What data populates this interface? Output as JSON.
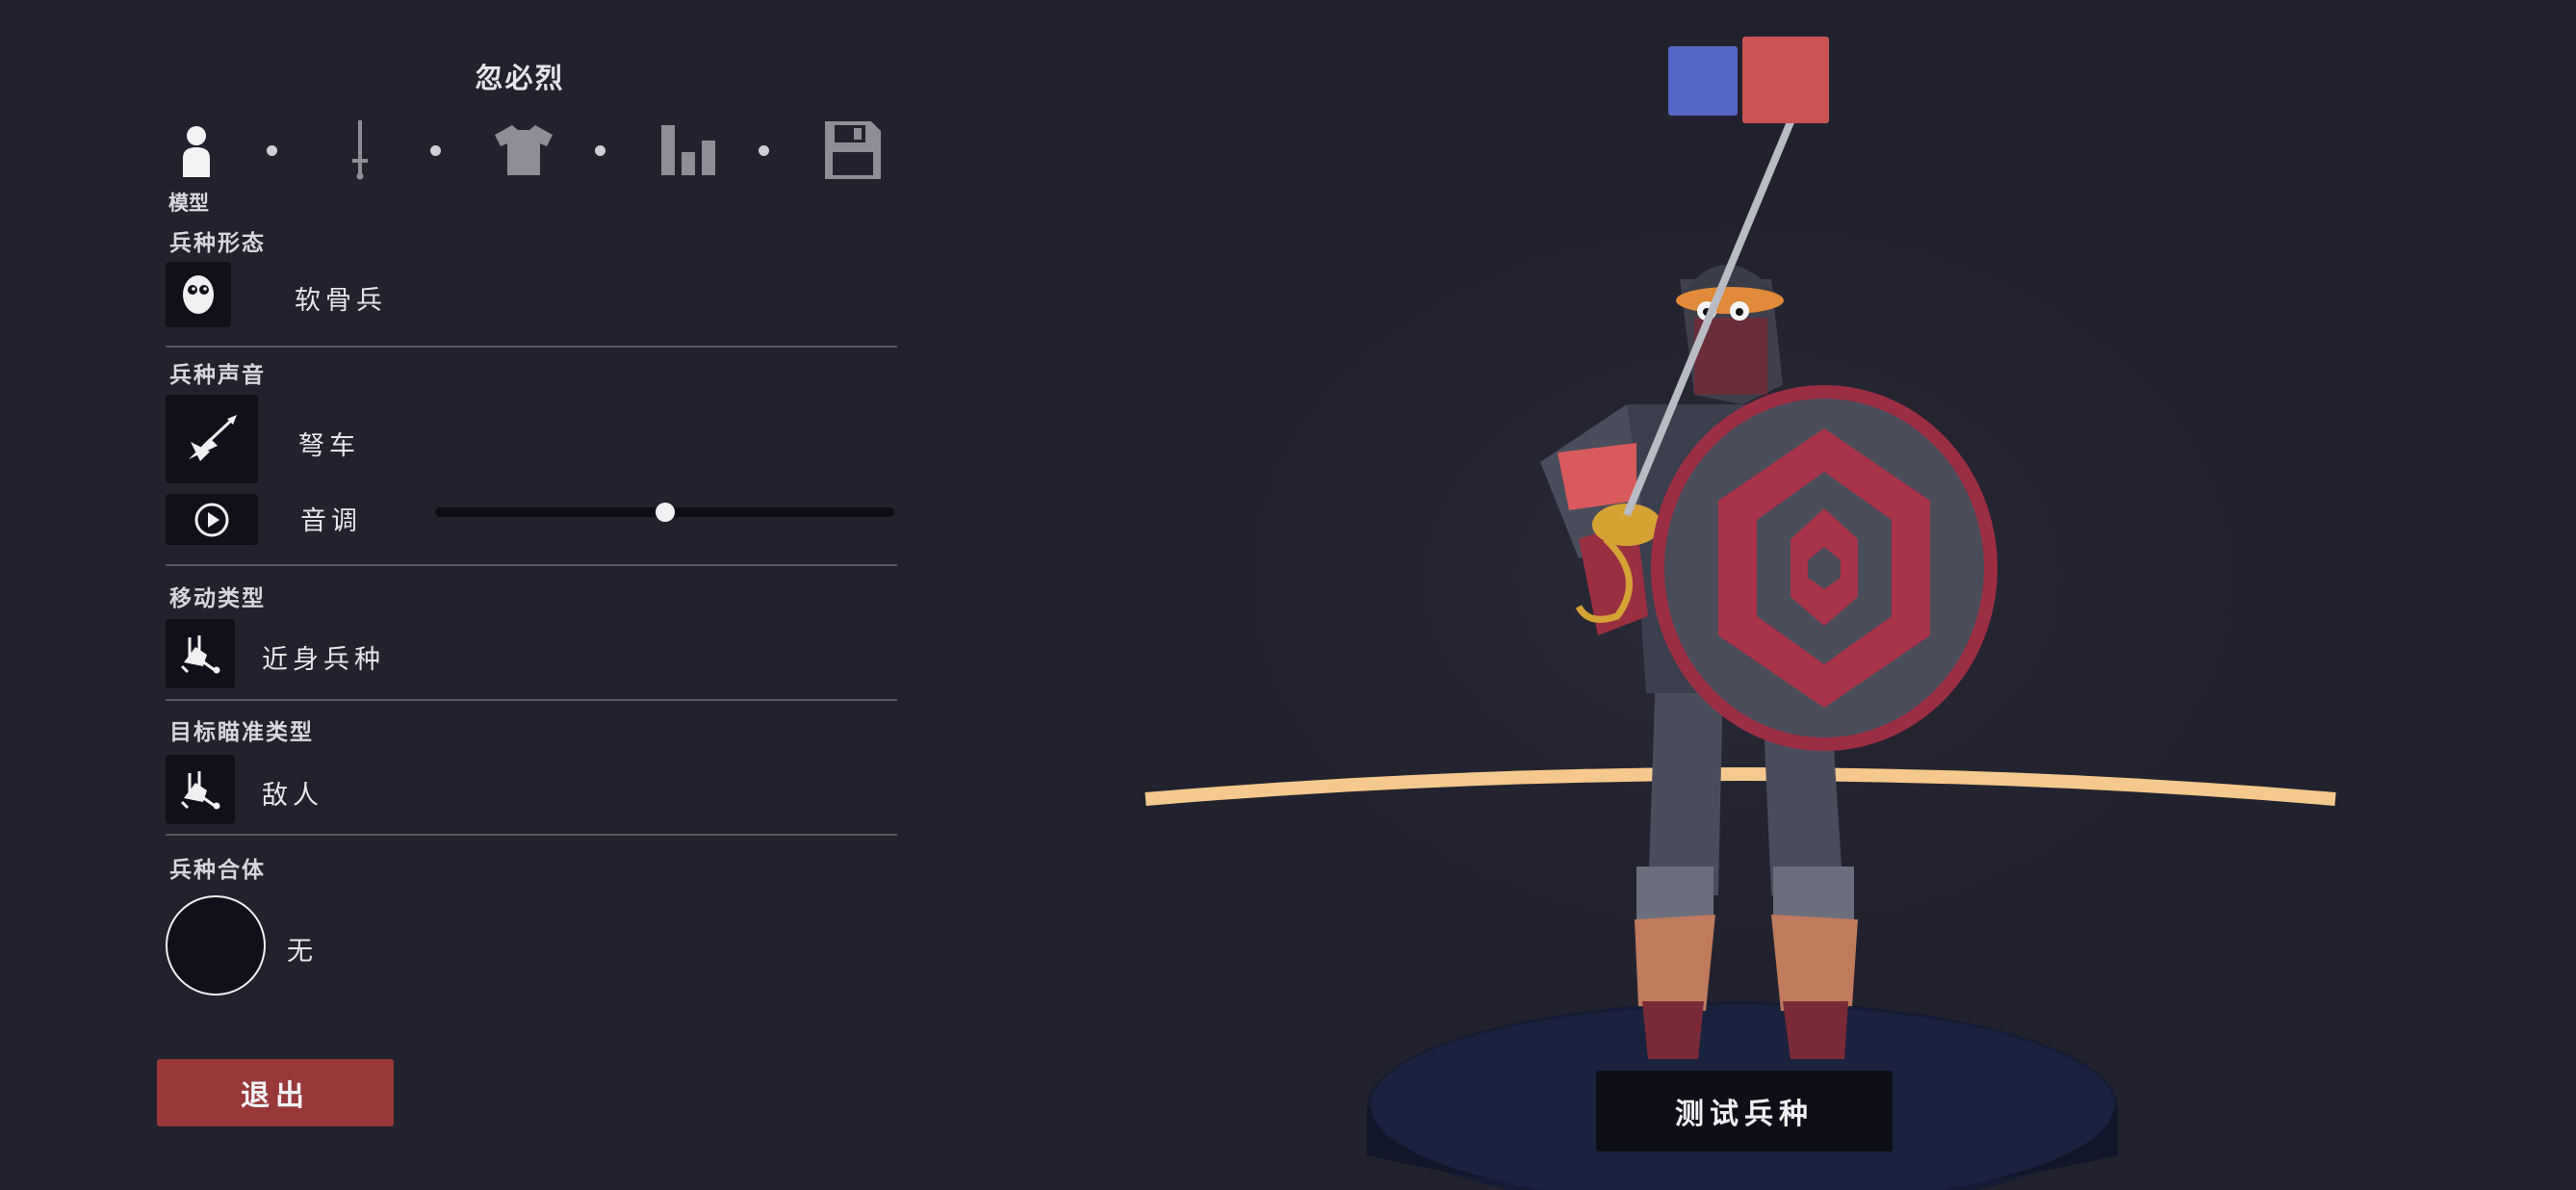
{
  "unit_name": "忽必烈",
  "tabs": [
    {
      "icon": "person-icon"
    },
    {
      "icon": "sword-icon"
    },
    {
      "icon": "shirt-icon"
    },
    {
      "icon": "bar-chart-icon"
    },
    {
      "icon": "floppy-disk-icon"
    }
  ],
  "active_tab_caption": "模型",
  "form": {
    "label": "兵种形态",
    "value": "软骨兵",
    "icon": "face-icon"
  },
  "voice": {
    "label": "兵种声音",
    "value": "弩车",
    "icon": "ballista-icon",
    "pitch_label": "音调",
    "pitch_level": 0.5,
    "play_icon": "play-icon"
  },
  "movement": {
    "label": "移动类型",
    "value": "近身兵种",
    "icon": "melee-unit-icon"
  },
  "targeting": {
    "label": "目标瞄准类型",
    "value": "敌人",
    "icon": "melee-unit-icon"
  },
  "combine": {
    "label": "兵种合体",
    "value": "无"
  },
  "exit_label": "退出",
  "test_label": "测试兵种",
  "colors": {
    "background": "#22222e",
    "exit": "#983838",
    "team_blue": "#5566c8",
    "team_red": "#c85454",
    "ring": "#f5c98d"
  }
}
